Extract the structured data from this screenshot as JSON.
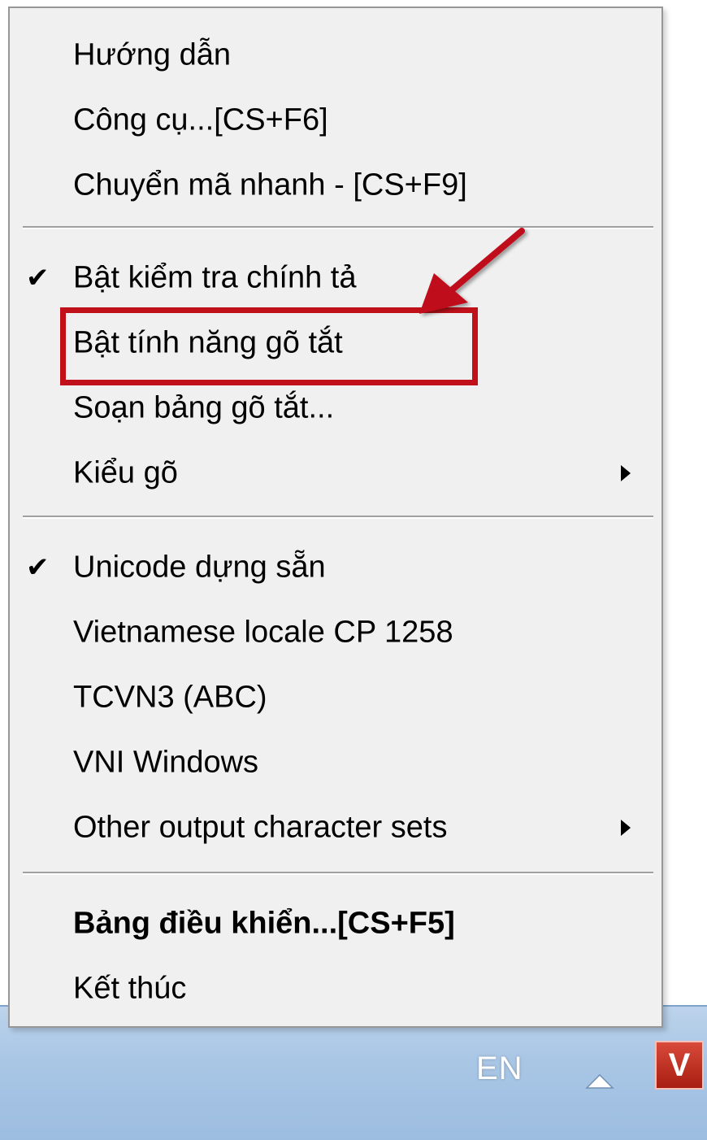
{
  "menu": {
    "items": [
      {
        "label": "Hướng dẫn",
        "checked": false,
        "submenu": false,
        "bold": false
      },
      {
        "label": "Công cụ...[CS+F6]",
        "checked": false,
        "submenu": false,
        "bold": false
      },
      {
        "label": "Chuyển mã nhanh - [CS+F9]",
        "checked": false,
        "submenu": false,
        "bold": false
      },
      {
        "label": "Bật kiểm tra chính tả",
        "checked": true,
        "submenu": false,
        "bold": false
      },
      {
        "label": "Bật tính năng gõ tắt",
        "checked": false,
        "submenu": false,
        "bold": false
      },
      {
        "label": "Soạn bảng gõ tắt...",
        "checked": false,
        "submenu": false,
        "bold": false
      },
      {
        "label": "Kiểu gõ",
        "checked": false,
        "submenu": true,
        "bold": false
      },
      {
        "label": "Unicode dựng sẵn",
        "checked": true,
        "submenu": false,
        "bold": false
      },
      {
        "label": "Vietnamese locale CP 1258",
        "checked": false,
        "submenu": false,
        "bold": false
      },
      {
        "label": "TCVN3 (ABC)",
        "checked": false,
        "submenu": false,
        "bold": false
      },
      {
        "label": "VNI Windows",
        "checked": false,
        "submenu": false,
        "bold": false
      },
      {
        "label": "Other output character sets",
        "checked": false,
        "submenu": true,
        "bold": false
      },
      {
        "label": "Bảng điều khiển...[CS+F5]",
        "checked": false,
        "submenu": false,
        "bold": true
      },
      {
        "label": "Kết thúc",
        "checked": false,
        "submenu": false,
        "bold": false
      }
    ],
    "check_glyph": "✔"
  },
  "annotation": {
    "highlight_color": "#c0111b",
    "highlighted_item": "Bật tính năng gõ tắt"
  },
  "taskbar": {
    "language": "EN",
    "tray_app_letter": "V",
    "tray_app_icon": "vietkey-icon",
    "show_hidden_icon": "chevron-up-icon"
  }
}
